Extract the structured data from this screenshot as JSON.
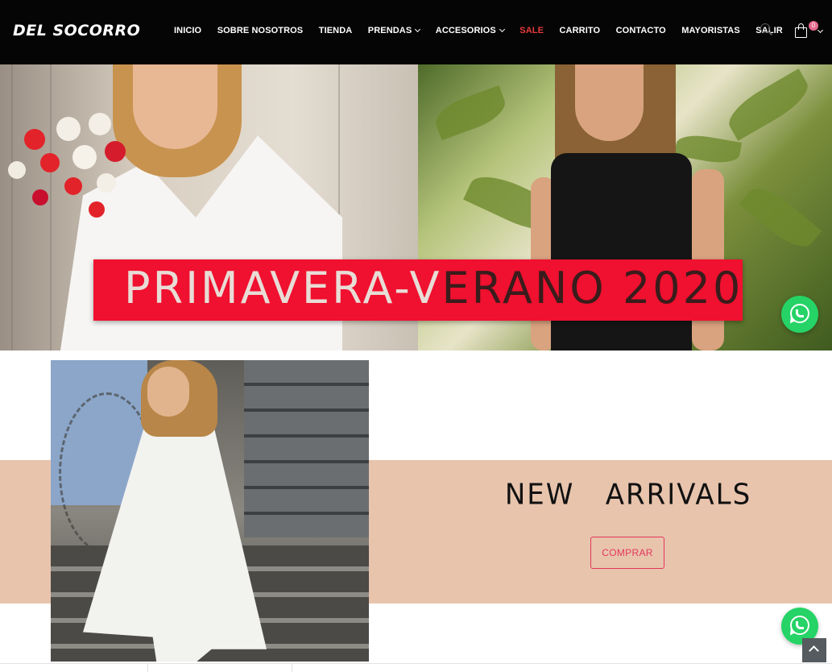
{
  "header": {
    "logo": "DEL SOCORRO",
    "nav": [
      {
        "label": "INICIO"
      },
      {
        "label": "SOBRE NOSOTROS"
      },
      {
        "label": "TIENDA"
      },
      {
        "label": "PRENDAS"
      },
      {
        "label": "ACCESORIOS"
      },
      {
        "label": "SALE"
      },
      {
        "label": "CARRITO"
      },
      {
        "label": "CONTACTO"
      },
      {
        "label": "MAYORISTAS"
      },
      {
        "label": "SALIR"
      }
    ],
    "cart_count": "0"
  },
  "hero": {
    "banner_text_part1": "PRIMAVERA-V",
    "banner_text_part2": "ERANO 2020"
  },
  "arrivals": {
    "title": "NEW   ARRIVALS",
    "button_label": "COMPRAR"
  },
  "colors": {
    "header_bg": "#050505",
    "sale_red": "#e83a3a",
    "banner_red": "#f0102f",
    "band_peach": "#e8c4ad",
    "button_pink": "#e3375a",
    "whatsapp_green": "#25d366"
  },
  "icons": [
    "search-icon",
    "cart-icon",
    "whatsapp-icon",
    "arrow-up-icon",
    "chevron-down-icon"
  ]
}
